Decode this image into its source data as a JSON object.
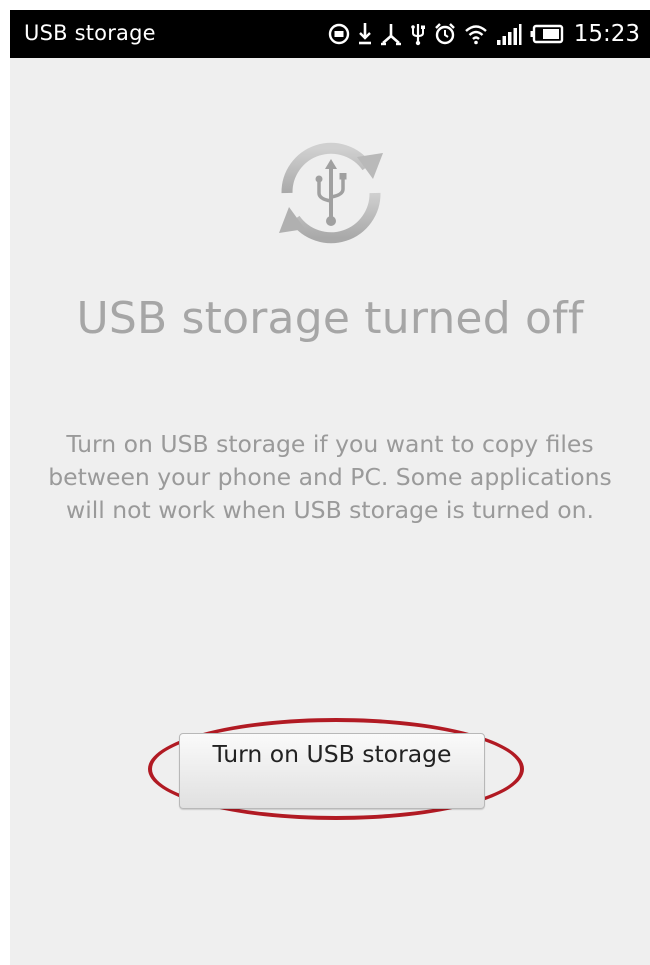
{
  "status_bar": {
    "title": "USB storage",
    "time": "15:23",
    "icons": [
      "message-icon",
      "download-icon",
      "usb-debug-icon",
      "usb-icon",
      "alarm-icon",
      "wifi-icon",
      "signal-icon",
      "battery-icon"
    ]
  },
  "main": {
    "icon": "usb-sync-icon",
    "headline": "USB storage turned off",
    "description": "Turn on USB storage if you want to copy files between your phone and PC. Some applications will not work when USB storage is turned on.",
    "button_label": "Turn on USB storage"
  },
  "colors": {
    "status_bar_bg": "#000000",
    "screen_bg": "#efefef",
    "muted_text": "#a6a6a6",
    "highlight_ring": "#b11a23"
  }
}
